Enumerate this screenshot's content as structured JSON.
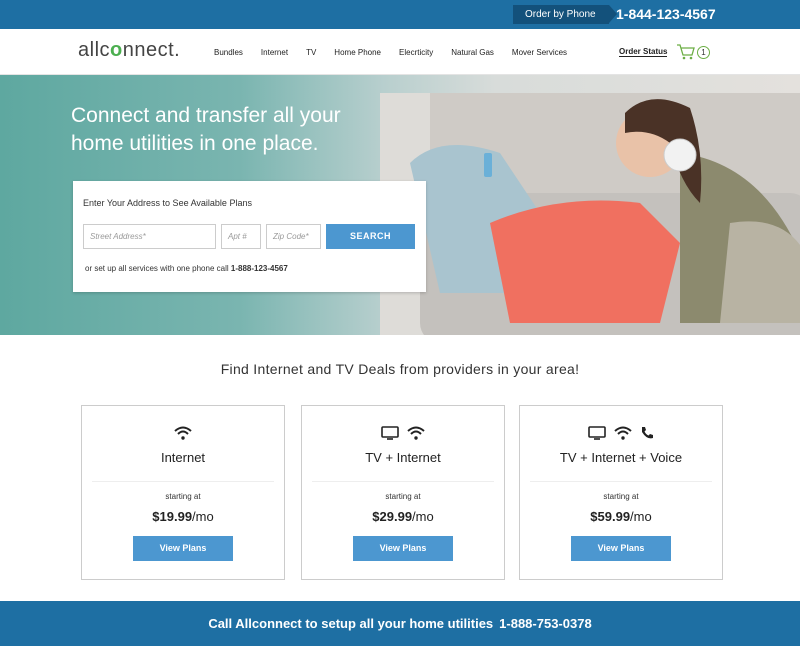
{
  "topbar": {
    "order_label": "Order by Phone",
    "phone": "1-844-123-4567",
    "bg_color": "#1e6fa3"
  },
  "nav": {
    "logo_prefix": "allc",
    "logo_mark": "o",
    "logo_suffix": "nnect.",
    "links": [
      "Bundles",
      "Internet",
      "TV",
      "Home Phone",
      "Elecrticity",
      "Natural Gas",
      "Mover Services"
    ],
    "order_status": "Order Status",
    "cart_count": "1",
    "cart_icon": "shopping-cart-icon"
  },
  "hero": {
    "headline": "Connect and transfer all your home utilities in one place.",
    "card_title": "Enter Your Address to See Available Plans",
    "street_placeholder": "Street Address*",
    "apt_placeholder": "Apt #",
    "zip_placeholder": "Zip Code*",
    "search_label": "SEARCH",
    "note_prefix": "or set up all services with one phone call",
    "note_phone": "1-888-123-4567"
  },
  "deals": {
    "heading": "Find Internet and TV Deals from providers in your area!",
    "plans": [
      {
        "title": "Internet",
        "starting": "starting at",
        "price": "$19.99",
        "unit": "/mo",
        "button": "View Plans",
        "icons": [
          "wifi-icon"
        ]
      },
      {
        "title": "TV + Internet",
        "starting": "starting at",
        "price": "$29.99",
        "unit": "/mo",
        "button": "View Plans",
        "icons": [
          "tv-icon",
          "wifi-icon"
        ]
      },
      {
        "title": "TV + Internet + Voice",
        "starting": "starting at",
        "price": "$59.99",
        "unit": "/mo",
        "button": "View Plans",
        "icons": [
          "tv-icon",
          "wifi-icon",
          "phone-icon"
        ]
      }
    ]
  },
  "footer": {
    "text": "Call Allconnect to setup all your home utilities",
    "phone": "1-888-753-0378"
  },
  "colors": {
    "accent_blue": "#4c97d0",
    "brand_green": "#4caf50"
  }
}
